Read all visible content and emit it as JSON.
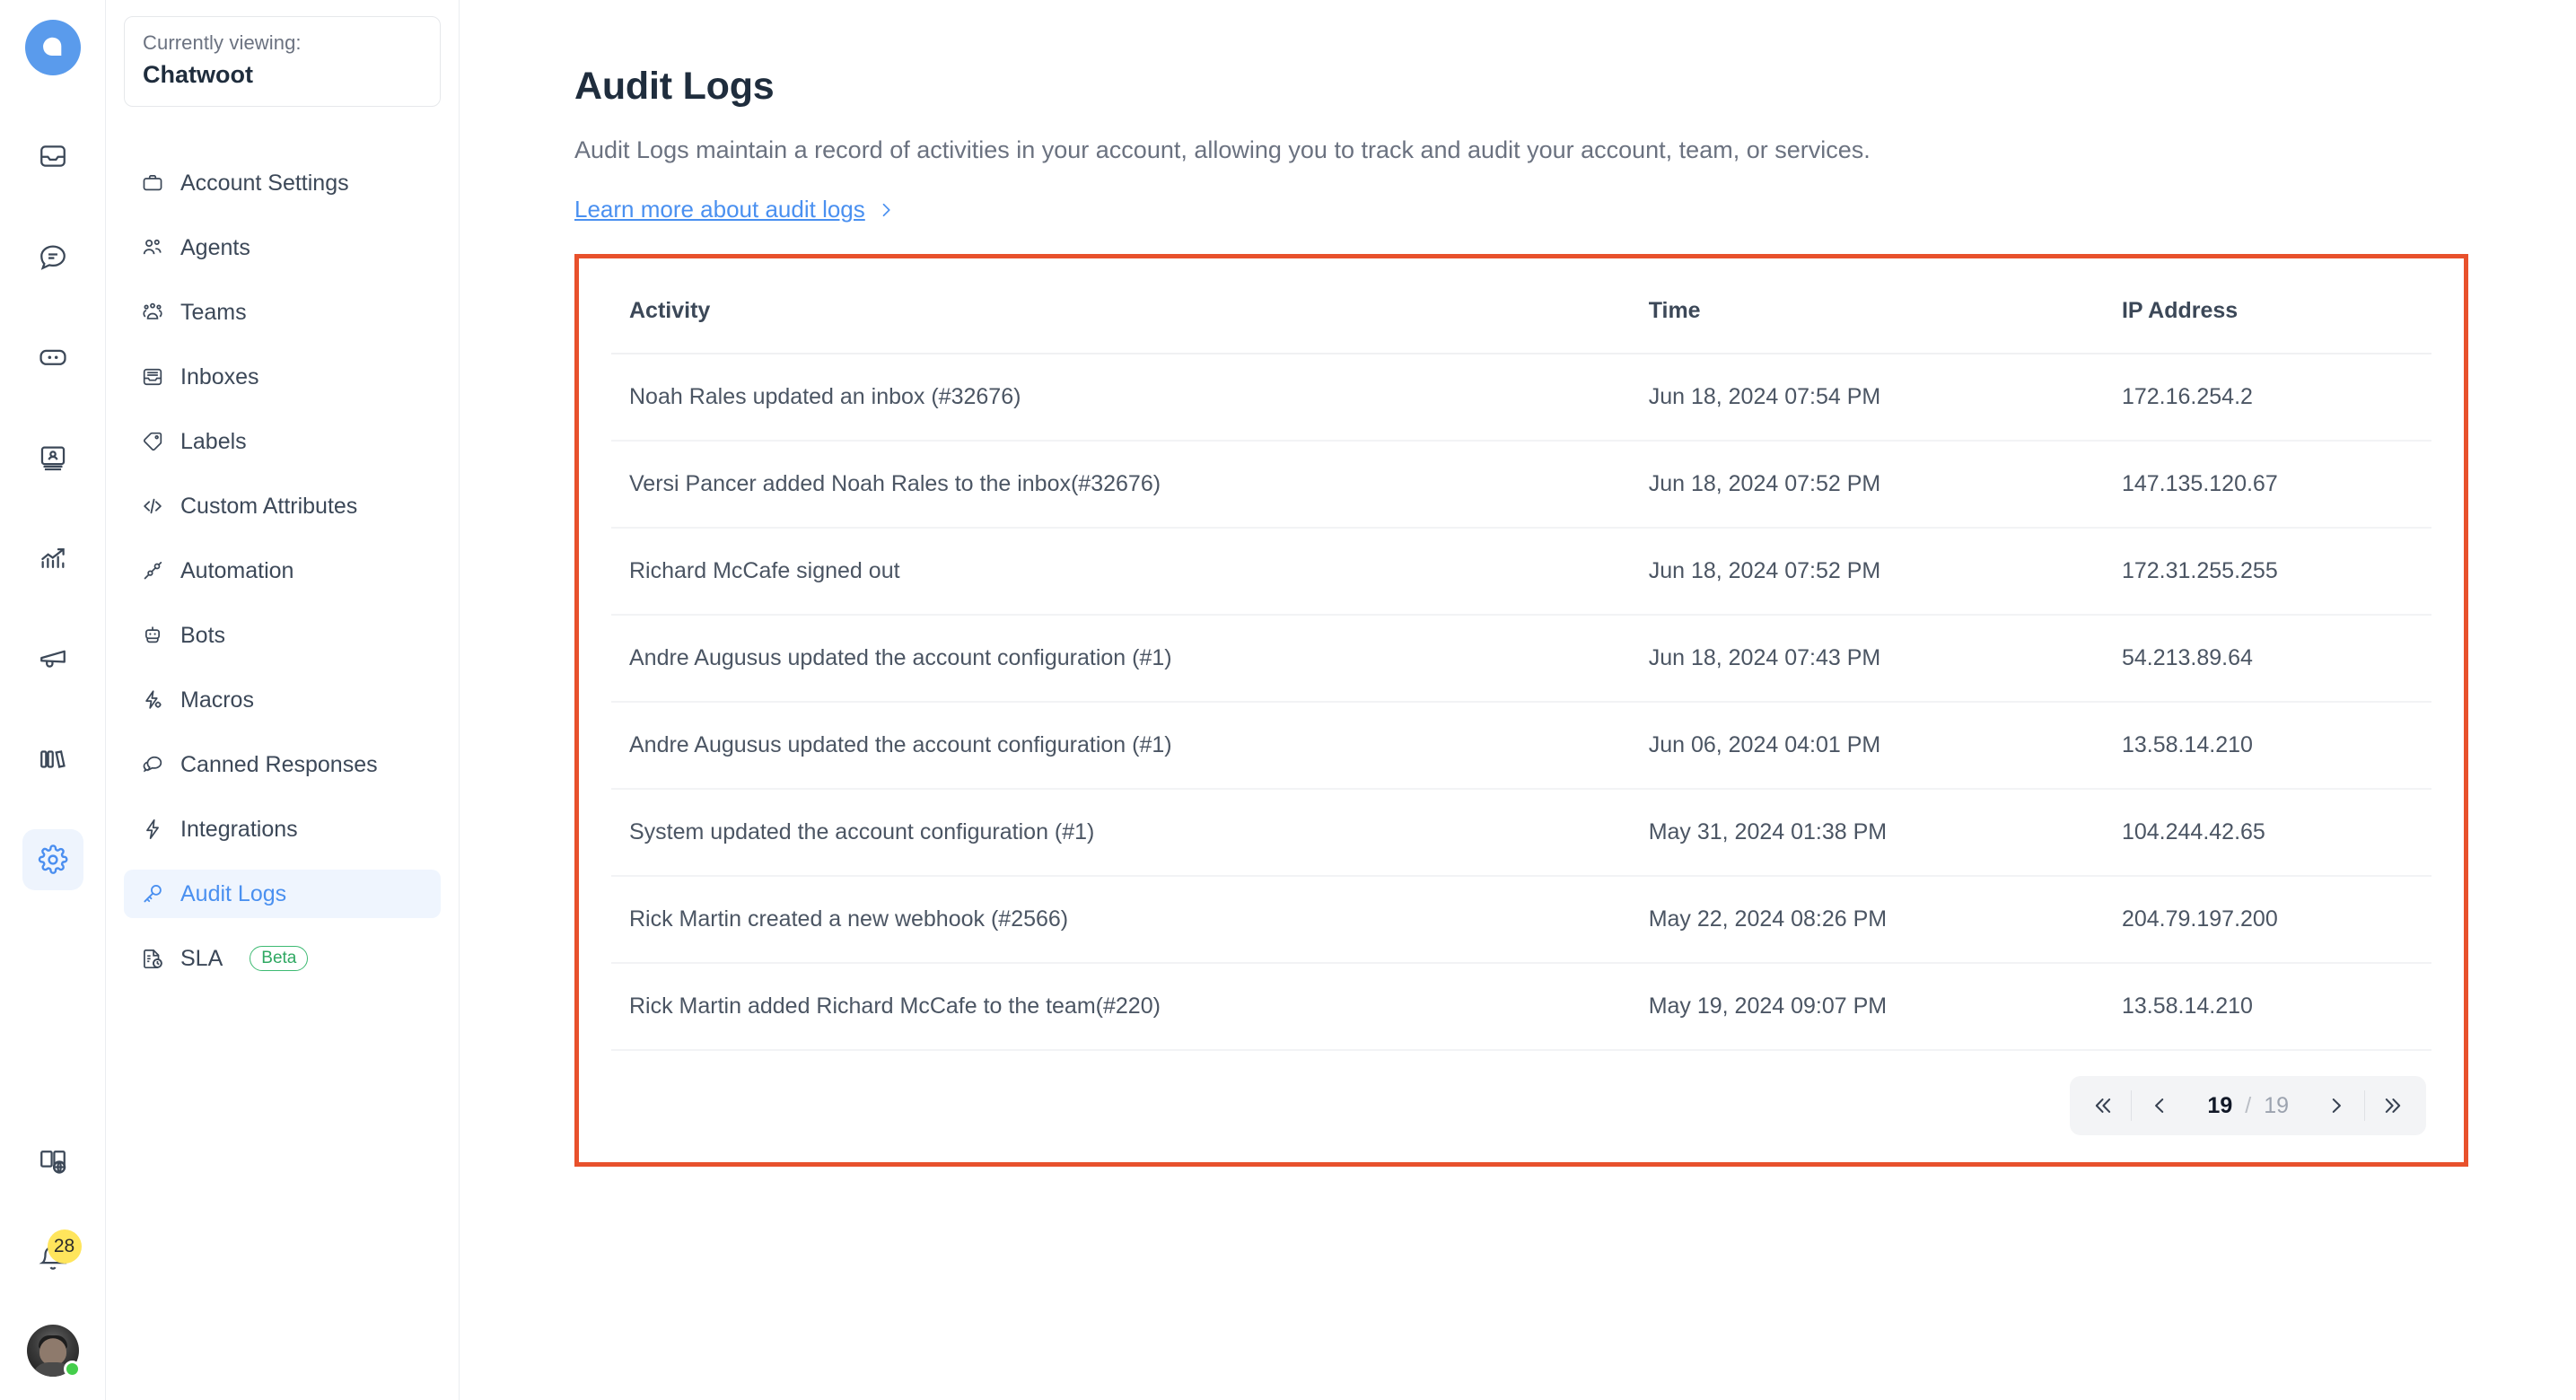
{
  "rail": {
    "logo_name": "chatwoot-logo",
    "items": [
      {
        "name": "conversations",
        "icon": "inbox-icon"
      },
      {
        "name": "chat",
        "icon": "chat-bubble-icon"
      },
      {
        "name": "captain",
        "icon": "captain-icon"
      },
      {
        "name": "contacts",
        "icon": "contacts-icon"
      },
      {
        "name": "reports",
        "icon": "reports-chart-icon"
      },
      {
        "name": "campaigns",
        "icon": "megaphone-icon"
      },
      {
        "name": "portal",
        "icon": "books-icon"
      },
      {
        "name": "settings",
        "icon": "gear-icon",
        "active": true
      }
    ],
    "bottom": [
      {
        "name": "docs",
        "icon": "book-globe-icon"
      },
      {
        "name": "notifications",
        "icon": "bell-icon",
        "badge": "28"
      },
      {
        "name": "profile",
        "icon": "avatar"
      }
    ]
  },
  "sidebar": {
    "viewing_label": "Currently viewing:",
    "account_name": "Chatwoot",
    "items": [
      {
        "label": "Account Settings",
        "icon": "briefcase-icon"
      },
      {
        "label": "Agents",
        "icon": "people-icon"
      },
      {
        "label": "Teams",
        "icon": "teams-icon"
      },
      {
        "label": "Inboxes",
        "icon": "inbox-list-icon"
      },
      {
        "label": "Labels",
        "icon": "tag-icon"
      },
      {
        "label": "Custom Attributes",
        "icon": "code-icon"
      },
      {
        "label": "Automation",
        "icon": "automation-icon"
      },
      {
        "label": "Bots",
        "icon": "robot-icon"
      },
      {
        "label": "Macros",
        "icon": "macros-icon"
      },
      {
        "label": "Canned Responses",
        "icon": "canned-response-icon"
      },
      {
        "label": "Integrations",
        "icon": "lightning-icon"
      },
      {
        "label": "Audit Logs",
        "icon": "key-icon",
        "active": true
      },
      {
        "label": "SLA",
        "icon": "sla-doc-icon",
        "badge": "Beta"
      }
    ]
  },
  "main": {
    "title": "Audit Logs",
    "description": "Audit Logs maintain a record of activities in your account, allowing you to track and audit your account, team, or services.",
    "learn_more": "Learn more about audit logs",
    "table": {
      "columns": [
        "Activity",
        "Time",
        "IP Address"
      ],
      "rows": [
        {
          "activity": "Noah Rales updated an inbox (#32676)",
          "time": "Jun 18, 2024 07:54 PM",
          "ip": "172.16.254.2"
        },
        {
          "activity": "Versi Pancer added Noah Rales to the inbox(#32676)",
          "time": "Jun 18, 2024 07:52 PM",
          "ip": "147.135.120.67"
        },
        {
          "activity": "Richard McCafe signed out",
          "time": "Jun 18, 2024 07:52 PM",
          "ip": "172.31.255.255"
        },
        {
          "activity": "Andre Augusus updated the account configuration (#1)",
          "time": "Jun 18, 2024 07:43 PM",
          "ip": "54.213.89.64"
        },
        {
          "activity": "Andre Augusus updated the account configuration (#1)",
          "time": "Jun 06, 2024 04:01 PM",
          "ip": "13.58.14.210"
        },
        {
          "activity": "System updated the account configuration (#1)",
          "time": "May 31, 2024 01:38 PM",
          "ip": "104.244.42.65"
        },
        {
          "activity": "Rick Martin created a new webhook (#2566)",
          "time": "May 22, 2024 08:26 PM",
          "ip": "204.79.197.200"
        },
        {
          "activity": "Rick Martin added Richard McCafe to the team(#220)",
          "time": "May 19, 2024 09:07 PM",
          "ip": "13.58.14.210"
        }
      ]
    },
    "pagination": {
      "first_label": "«",
      "prev_label": "‹",
      "current_page": "19",
      "separator": "/",
      "total_pages": "19",
      "next_label": "›",
      "last_label": "»"
    }
  },
  "colors": {
    "accent_blue": "#4a90f0",
    "highlight_red": "#e8512c",
    "badge_yellow": "#ffe55c",
    "beta_green": "#2fa862",
    "logo_blue": "#5a9bec"
  }
}
